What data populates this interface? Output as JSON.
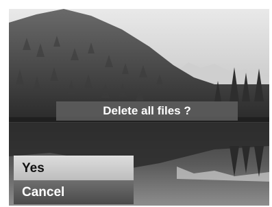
{
  "dialog": {
    "message": "Delete all files ?"
  },
  "menu": {
    "options": [
      {
        "label": "Yes",
        "state": "unselected"
      },
      {
        "label": "Cancel",
        "state": "selected"
      }
    ]
  },
  "background": {
    "subject": "mountain-lake-photo"
  },
  "colors": {
    "banner": "#5f5f5f",
    "option_light": "#cfcfcf",
    "option_dark": "#555555"
  }
}
